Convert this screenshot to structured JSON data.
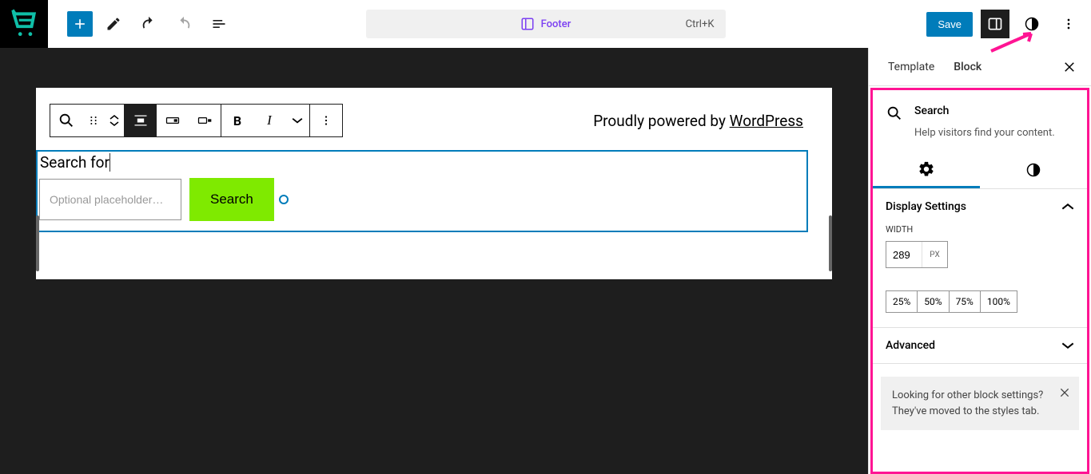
{
  "header": {
    "center_title": "Footer",
    "center_shortcut": "Ctrl+K",
    "save_label": "Save"
  },
  "canvas": {
    "powered_prefix": "Proudly powered by ",
    "powered_link": "WordPress",
    "search_label": "Search for",
    "search_placeholder": "Optional placeholder…",
    "search_button": "Search"
  },
  "sidebar": {
    "tabs": {
      "template": "Template",
      "block": "Block"
    },
    "block_info": {
      "title": "Search",
      "desc": "Help visitors find your content."
    },
    "display_settings": {
      "title": "Display Settings",
      "width_label": "Width",
      "width_value": "289",
      "width_unit": "PX",
      "presets": [
        "25%",
        "50%",
        "75%",
        "100%"
      ]
    },
    "advanced_title": "Advanced",
    "notice": "Looking for other block settings? They've moved to the styles tab."
  }
}
